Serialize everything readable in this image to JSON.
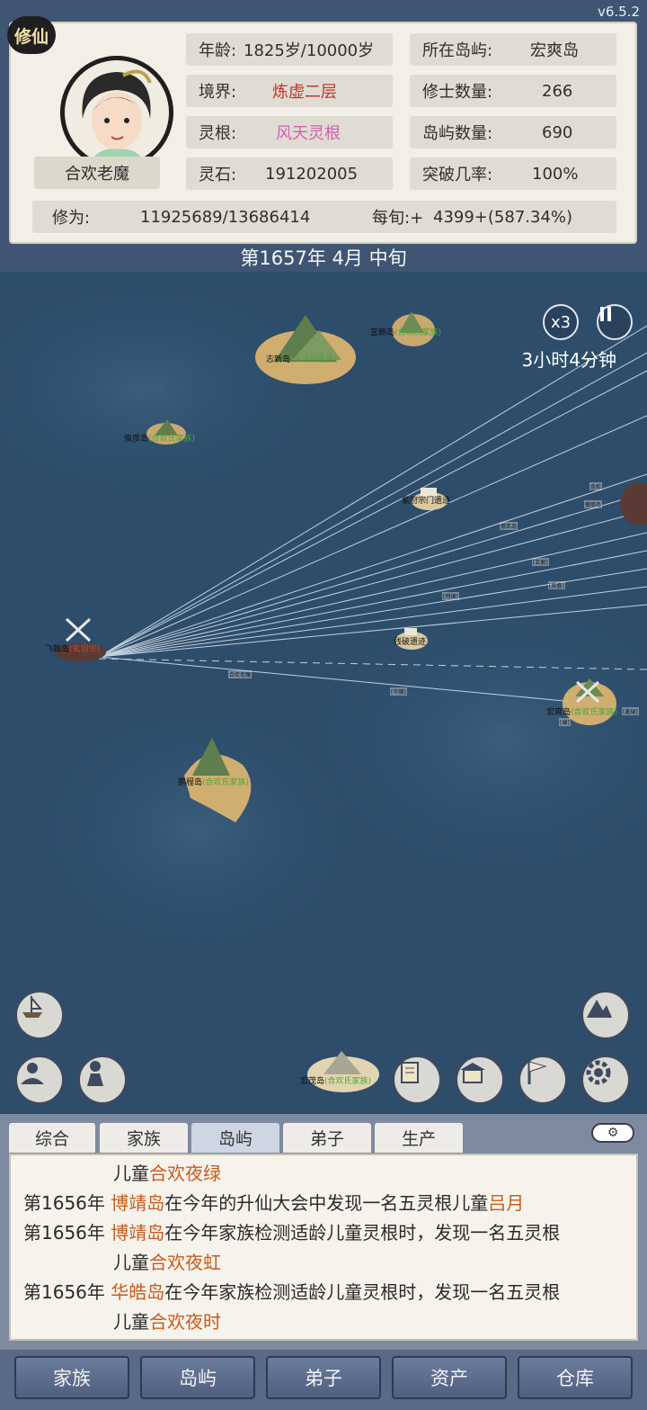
{
  "version": "v6.5.2",
  "badge": "修仙",
  "player": {
    "name": "合欢老魔"
  },
  "stats": {
    "age_label": "年龄:",
    "age_value": "1825岁/10000岁",
    "realm_label": "境界:",
    "realm_value": "炼虚二层",
    "root_label": "灵根:",
    "root_value": "风天灵根",
    "stone_label": "灵石:",
    "stone_value": "191202005",
    "island_label": "所在岛屿:",
    "island_value": "宏爽岛",
    "cultivators_label": "修士数量:",
    "cultivators_value": "266",
    "islands_label": "岛屿数量:",
    "islands_value": "690",
    "breakthrough_label": "突破几率:",
    "breakthrough_value": "100%",
    "cultivation_label": "修为:",
    "cultivation_value": "11925689/13686414",
    "per_xun_label": "每旬:+",
    "per_xun_value": "4399+(587.34%)"
  },
  "date": "第1657年 4月 中旬",
  "map": {
    "speed": "x3",
    "pause_icon": "pause-icon",
    "timer": "3小时4分钟",
    "islands": [
      {
        "name": "宣朗岛",
        "faction": "(合欢氏家族)"
      },
      {
        "name": "志新岛",
        "faction": "(合欢氏家族)"
      },
      {
        "name": "俊彦岛",
        "faction": "(合欢氏家族)"
      },
      {
        "name": "紫府宗门遗迹",
        "faction": ""
      },
      {
        "name": "飞翰岛",
        "faction": "(玄羽宗)"
      },
      {
        "name": "残破遗迹",
        "faction": ""
      },
      {
        "name": "宏爽岛",
        "faction": "(合欢氏家族)"
      },
      {
        "name": "鹏程岛",
        "faction": "(合欢氏家族)"
      },
      {
        "name": "宏茂岛",
        "faction": "(合欢氏家族)"
      }
    ],
    "mini_labels": [
      "金松",
      "傲丽岛",
      "挪若岛",
      "[玄丽]",
      "[奕盛]",
      "[鸣镜]",
      "合欢老魔",
      "[华爍]",
      "[鑫瑞]",
      "[编]"
    ]
  },
  "log_tabs": [
    "综合",
    "家族",
    "岛屿",
    "弟子",
    "生产"
  ],
  "log_active_tab": "岛屿",
  "logs": [
    {
      "year": "",
      "island": "",
      "text": "儿童",
      "child": "合欢夜绿"
    },
    {
      "year": "第1656年",
      "island": "博靖岛",
      "text": "在今年的升仙大会中发现一名五灵根儿童",
      "child": "吕月"
    },
    {
      "year": "第1656年",
      "island": "博靖岛",
      "text": "在今年家族检测适龄儿童灵根时，发现一名五灵根",
      "child": ""
    },
    {
      "year": "",
      "island": "",
      "text": "儿童",
      "child": "合欢夜虹"
    },
    {
      "year": "第1656年",
      "island": "华皓岛",
      "text": "在今年家族检测适龄儿童灵根时，发现一名五灵根",
      "child": ""
    },
    {
      "year": "",
      "island": "",
      "text": "儿童",
      "child": "合欢夜时"
    }
  ],
  "bottom_nav": [
    "家族",
    "岛屿",
    "弟子",
    "资产",
    "仓库"
  ],
  "colors": {
    "frame": "#3f5573",
    "sea": "#2d4d6b",
    "realm": "#c8302a",
    "root": "#d062b0",
    "highlight": "#c65c1c",
    "faction": "#4aa63a"
  }
}
